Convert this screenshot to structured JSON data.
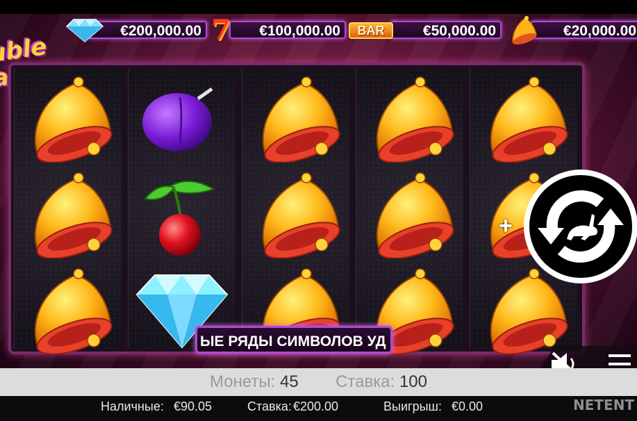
{
  "jackpots": [
    {
      "icon": "diamond-icon",
      "value": "€200,000.00"
    },
    {
      "icon": "seven-icon",
      "value": "€100,000.00",
      "icon_text": "7"
    },
    {
      "icon": "bar-icon",
      "value": "€50,000.00",
      "icon_text": "BAR"
    },
    {
      "icon": "bell-icon",
      "value": "€20,000.00"
    }
  ],
  "logo": {
    "line1": "uble",
    "line2": "acks"
  },
  "reels": [
    [
      "bell",
      "bell",
      "bell"
    ],
    [
      "plum",
      "cherry",
      "diamond"
    ],
    [
      "bell",
      "bell",
      "bell"
    ],
    [
      "bell",
      "bell",
      "bell"
    ],
    [
      "bell",
      "bell",
      "bell"
    ]
  ],
  "ticker": {
    "text": "ЫЕ РЯДЫ СИМВОЛОВ УД"
  },
  "controls": {
    "turbo_icon": "turbo-spin-rabbit-icon",
    "plus_label": "+",
    "mute_icon": "speaker-muted-icon",
    "menu_icon": "hamburger-menu-icon"
  },
  "coins": {
    "coins_label": "Монеты:",
    "coins_value": "45",
    "bet_label": "Ставка:",
    "bet_value": "100"
  },
  "status": {
    "cash_label": "Наличные:",
    "cash_value": "€90.05",
    "bet_label": "Ставка:",
    "bet_value": "€200.00",
    "win_label": "Выигрыш:",
    "win_value": "€0.00"
  },
  "brand": "NETENT",
  "colors": {
    "frame": "#7a2b6a",
    "accent": "#b04cd0",
    "gold": "#ffc21a"
  }
}
